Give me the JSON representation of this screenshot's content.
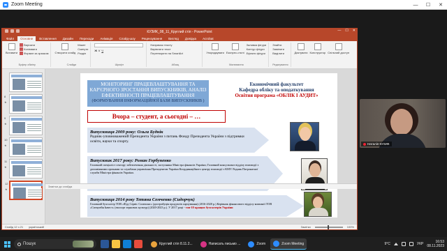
{
  "zoom": {
    "title": "Zoom Meeting",
    "controls": {
      "min": "—",
      "max": "☐",
      "close": "✕"
    }
  },
  "ppt": {
    "window_title": "КУЗИК_08_11_Круглий стіл - PowerPoint",
    "tabs": [
      "Файл",
      "Основне",
      "Вставлення",
      "Дизайн",
      "Переходи",
      "Анімація",
      "Слайд-шоу",
      "Рецензування",
      "Вигляд",
      "Довідка",
      "Acrobat"
    ],
    "active_tab": 1,
    "ribbon": {
      "paste": "Вставити",
      "cut": "Вирізати",
      "copy": "Копіювати",
      "format": "Формат за зразком",
      "clipboard": "Буфер обміну",
      "new_slide": "Створити слайд",
      "layout": "Макет",
      "reset": "Скинути",
      "section": "Розділ",
      "slides": "Слайди",
      "font": "Шрифт",
      "paragraph": "Абзац",
      "direction": "Напрямок тексту",
      "align": "Вирівняти текст",
      "smartart": "Перетворити на SmartArt",
      "drawing": "Малювання",
      "arrange": "Упорядкувати",
      "styles": "Експрес-стилі",
      "fill": "Заливка фігури",
      "outline": "Контур фігури",
      "effects": "Ефекти фігури",
      "find": "Знайти",
      "replace": "Замінити",
      "select": "Виділити",
      "editing": "Редагування",
      "voice": "Диктувати",
      "designer": "Конструктор",
      "share": "Спільний доступ"
    },
    "thumbnails": [
      {
        "num": "",
        "star": ""
      },
      {
        "num": "8",
        "star": "★"
      },
      {
        "num": "9",
        "star": "★"
      },
      {
        "num": "10",
        "star": "★"
      },
      {
        "num": "11",
        "star": "★"
      },
      {
        "num": "12",
        "star": "★"
      }
    ],
    "notes": "Замітки до слайда",
    "status": {
      "slide": "Слайд 12 з 21",
      "lang": "український",
      "notes_btn": "Замітки",
      "zoom": "100%"
    }
  },
  "slide": {
    "header_left": "МОНІТОРИНГ ПРАЦЕВЛАШТУВАННЯ ТА КАР'ЄРНОГО ЗРОСТАННЯ ВИПУСКНИКІВ, АНАЛІЗ ЕФЕКТИВНОСТІ ПРАЦЕВЛАШТУВАННЯ",
    "header_left_sub": "(ФОРМУВАННЯ ІНФОРМАЦІЙНОЇ БАЗИ ВИПУСКНИКІВ )",
    "header_right_1": "Економічний факультет",
    "header_right_2": "Кафедра обліку та оподаткування",
    "header_right_3": "Освітня програма «ОБЛІК І АУДИТ»",
    "slogan": "Вчора – студент, а сьогодні – …",
    "cards": [
      {
        "title": "Випускниця 2009 року: Ольга Буднік",
        "desc": "Радник-уповноважений Президента України з питань Фонду Президента України з підтримки освіти, науки та спорту."
      },
      {
        "title": "Випускник 2017 року: Роман Горбуненко",
        "desc": "Головний спеціаліст сектору забезпечення діяльності, заступника Міністра фінансів України; Головний консультант відділу взаємодії з допоміжними органами та службами управління Президентом України Координаційного центру взаємодії з КМУ. Радник Патронатної служби Міністра фінансів України."
      },
      {
        "title": "Випускниця 2014 року Тетяна Семченко (Сидорчук)",
        "desc": "Головний бухгалтер ТОВ «Фуд Сервіс Солюшнс» (дистрибуція продуктів харчування) (2016-2020 р.) Керівник фінансового відділу компанії ТОВ «Спецпейн Інвест» (експорт зернових культур) (2020-2023 р.). У 2017 році -",
        "highlight": "топ-10",
        "tail": "кращих бухгалтерів України"
      }
    ]
  },
  "participant": {
    "name": "Наталія КУЗИК"
  },
  "taskbar": {
    "search": "Пошук",
    "apps": [
      {
        "label": "Круглий стіл 8.11.2...",
        "color": "#e8a33d"
      },
      {
        "label": "Написать письмо ...",
        "color": "#d63384"
      },
      {
        "label": "Zoom",
        "color": "#2d8cff"
      },
      {
        "label": "Zoom Meeting",
        "color": "#2d8cff",
        "active": true
      }
    ],
    "temp": "9°C",
    "lang": "УКР",
    "time": "16:53",
    "date": "08.11.2023"
  }
}
